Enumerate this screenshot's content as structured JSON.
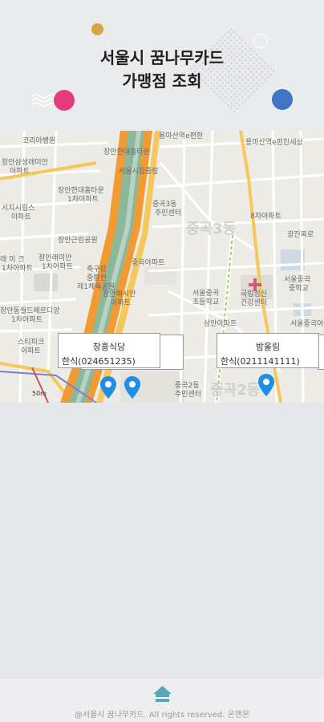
{
  "header": {
    "title_line1": "서울시 꿈나무카드",
    "title_line2": "가맹점 조회"
  },
  "map": {
    "labels": [
      {
        "text": "코리아병원"
      },
      {
        "text": "장안현대홈타운"
      },
      {
        "text": "장안삼성래미안"
      },
      {
        "text": "아파트"
      },
      {
        "text": "장안현대홈타운"
      },
      {
        "text": "1차아파트"
      },
      {
        "text": "서울시립중랑"
      },
      {
        "text": "서치시립스"
      },
      {
        "text": "아파트"
      },
      {
        "text": "장안근린공원"
      },
      {
        "text": "래 미 크"
      },
      {
        "text": "1차아파트"
      },
      {
        "text": "장안래미안"
      },
      {
        "text": "1차아파트"
      },
      {
        "text": "축구장"
      },
      {
        "text": "중랑천"
      },
      {
        "text": "제1체육공원"
      },
      {
        "text": "장안해시안"
      },
      {
        "text": "아파트"
      },
      {
        "text": "장안동월드메르디앙"
      },
      {
        "text": "1차아파트"
      },
      {
        "text": "스티피크"
      },
      {
        "text": "아파트"
      },
      {
        "text": "중곡3동"
      },
      {
        "text": "주민센터"
      },
      {
        "text": "중곡아파트"
      },
      {
        "text": "서울중곡"
      },
      {
        "text": "초등학교"
      },
      {
        "text": "국립정신"
      },
      {
        "text": "건강센터"
      },
      {
        "text": "삼안아파트"
      },
      {
        "text": "8차아파트"
      },
      {
        "text": "용마산역e편한세상"
      },
      {
        "text": "광진복로"
      },
      {
        "text": "서울중곡"
      },
      {
        "text": "중학교"
      },
      {
        "text": "중곡2동"
      },
      {
        "text": "주민센터"
      },
      {
        "text": "중곡3동"
      },
      {
        "text": "용마산역e편한"
      },
      {
        "text": "중곡2동"
      },
      {
        "text": "서울중곡아파"
      }
    ],
    "popups": [
      {
        "name": "창흥식당",
        "desc": "한식(024651235)"
      },
      {
        "name": "밤울림",
        "desc": "한식(0211141111)"
      }
    ],
    "scale": "50m"
  },
  "footer": {
    "copyright": "@서울시 꿈나무카드. All rights reserved. 온앤온"
  },
  "colors": {
    "river": "#8bb89a",
    "expressway": "#f39a32",
    "main_road": "#f6c75a",
    "pin": "#1f8fe6",
    "home_icon": "#5aa6b4"
  }
}
